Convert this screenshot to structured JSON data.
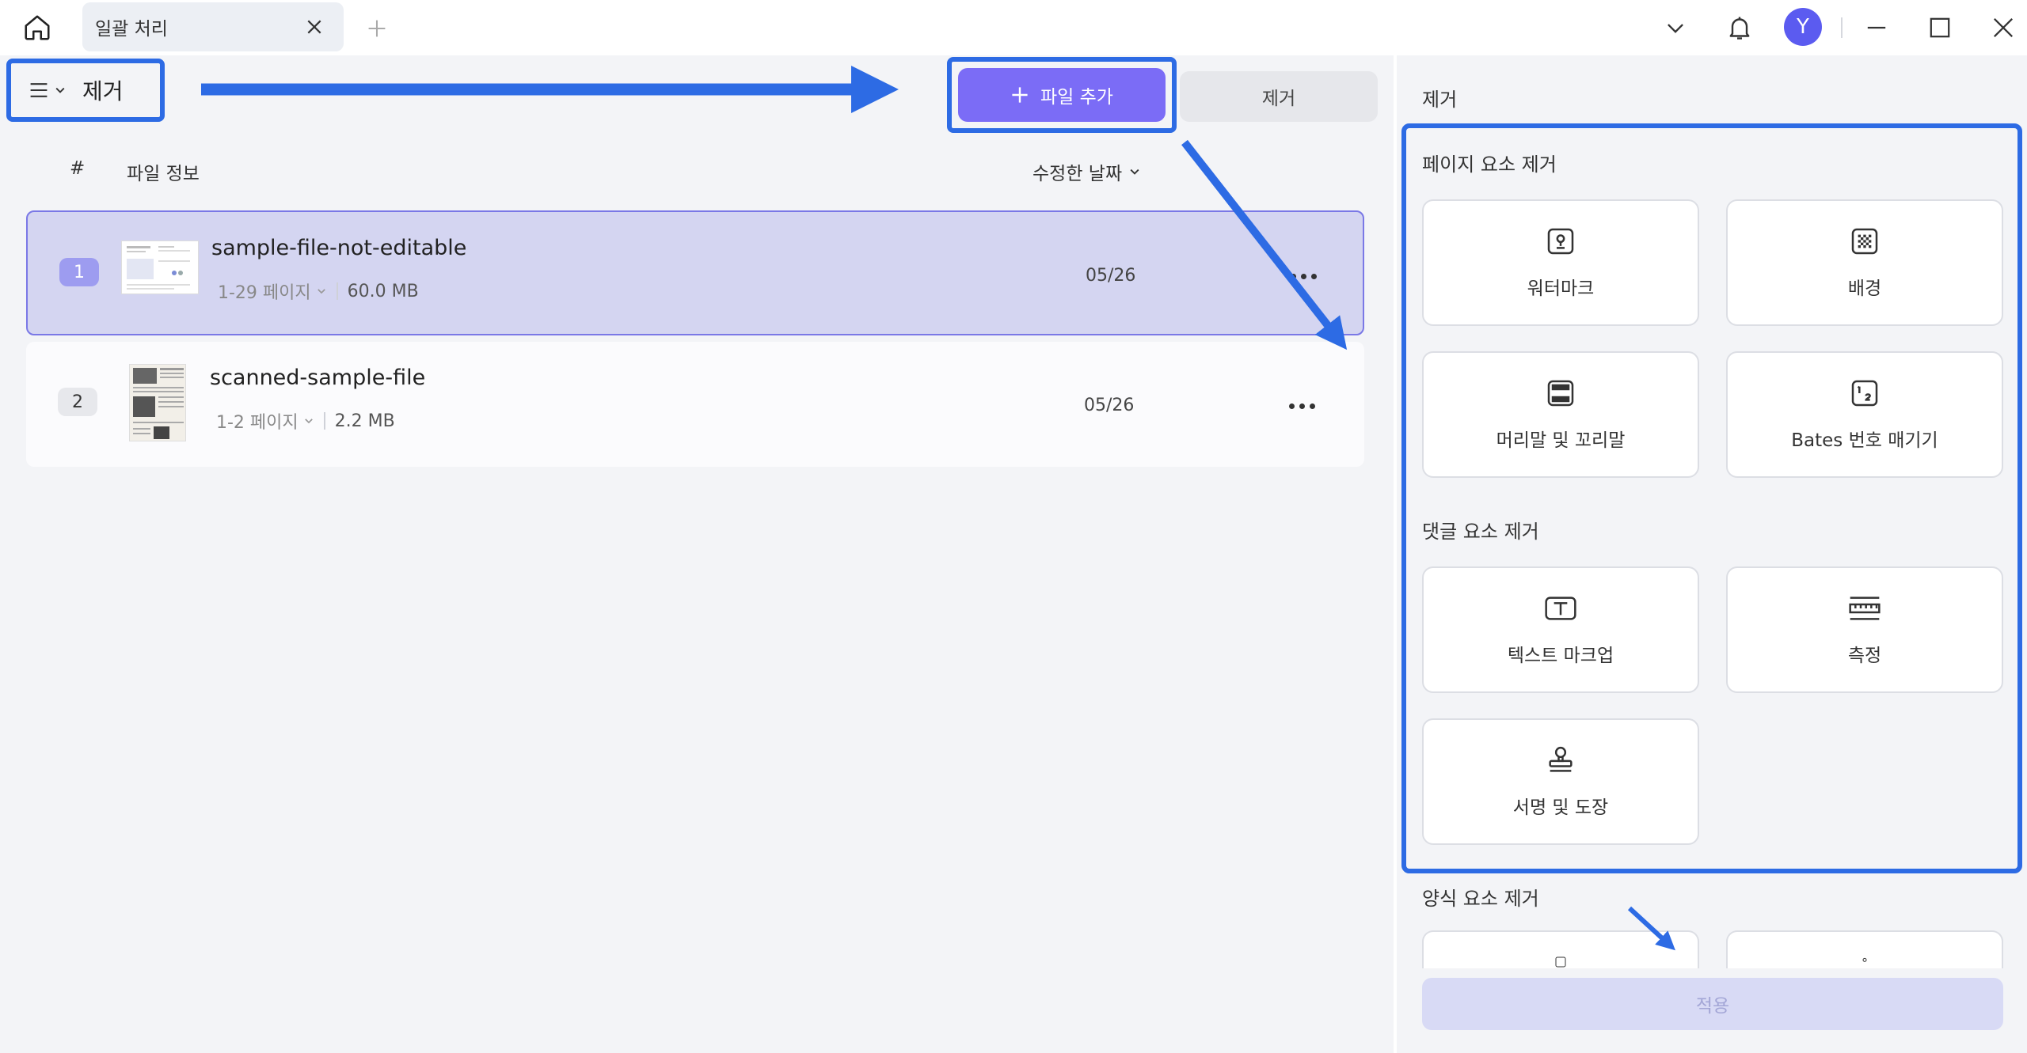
{
  "titlebar": {
    "tab_title": "일괄 처리",
    "avatar_letter": "Y"
  },
  "toolbar": {
    "menu_label": "제거",
    "add_file_label": "파일 추가",
    "remove_label": "제거"
  },
  "list": {
    "headers": {
      "num": "#",
      "info": "파일 정보",
      "date": "수정한 날짜"
    },
    "files": [
      {
        "num": "1",
        "name": "sample-file-not-editable",
        "pages": "1-29 페이지",
        "size": "60.0 MB",
        "date": "05/26",
        "selected": true
      },
      {
        "num": "2",
        "name": "scanned-sample-file",
        "pages": "1-2 페이지",
        "size": "2.2 MB",
        "date": "05/26",
        "selected": false
      }
    ]
  },
  "panel": {
    "title": "제거",
    "page_section": {
      "title": "페이지 요소 제거",
      "items": [
        {
          "label": "워터마크",
          "icon": "watermark-icon"
        },
        {
          "label": "배경",
          "icon": "background-icon"
        },
        {
          "label": "머리말 및 꼬리말",
          "icon": "header-footer-icon"
        },
        {
          "label": "Bates 번호 매기기",
          "icon": "bates-numbering-icon"
        }
      ]
    },
    "comment_section": {
      "title": "댓글 요소 제거",
      "items": [
        {
          "label": "텍스트 마크업",
          "icon": "text-markup-icon"
        },
        {
          "label": "측정",
          "icon": "measure-icon"
        },
        {
          "label": "서명 및 도장",
          "icon": "stamp-icon"
        }
      ]
    },
    "form_section": {
      "title": "양식 요소 제거"
    },
    "apply_label": "적용"
  },
  "colors": {
    "accent": "#7b6cf6",
    "highlight": "#2d6be4",
    "selected_row": "#d4d5f1"
  }
}
